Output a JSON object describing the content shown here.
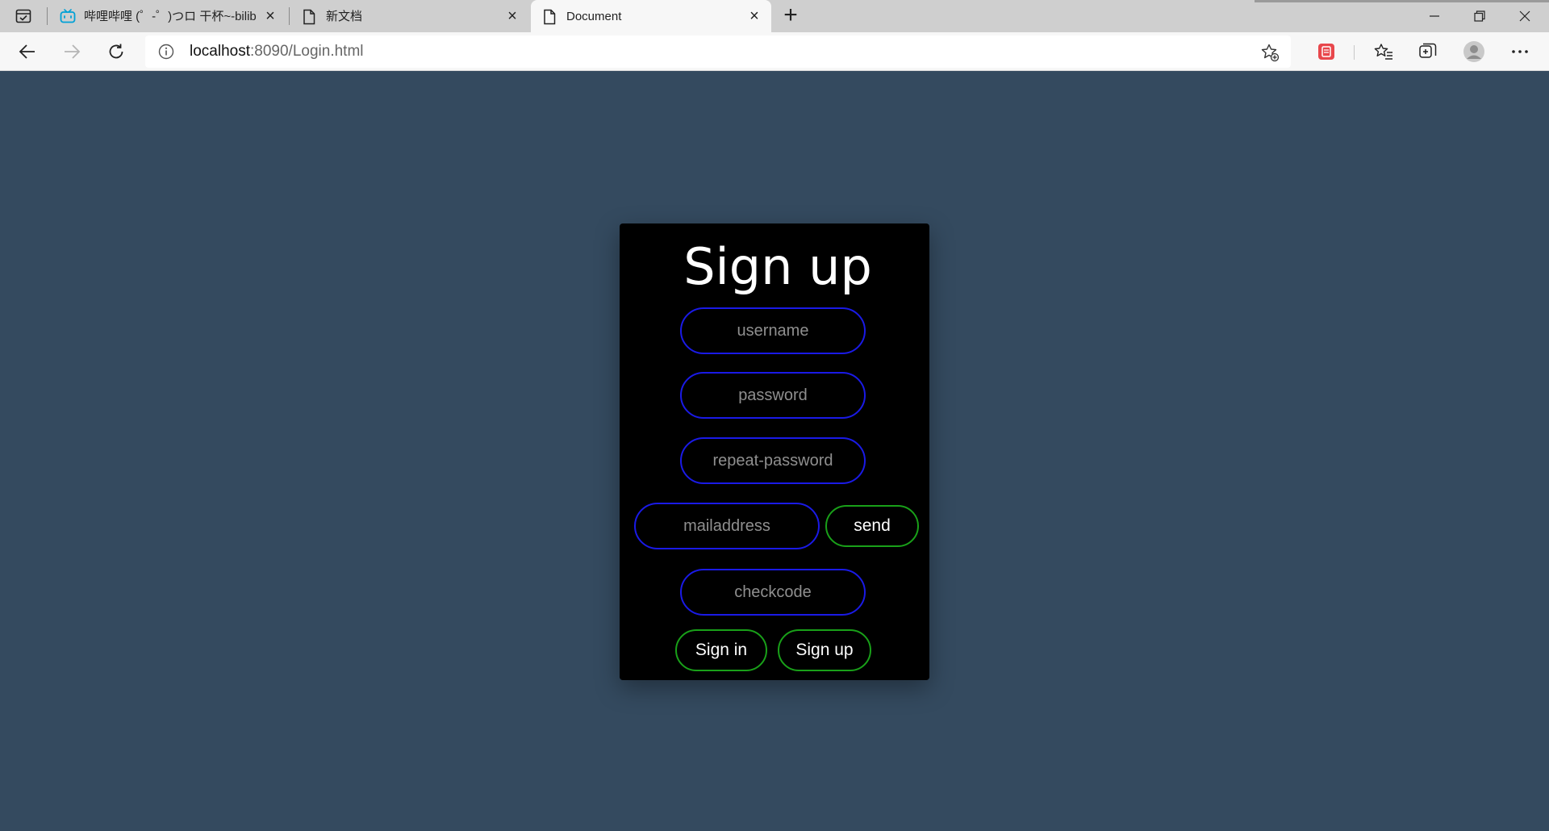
{
  "browser": {
    "tabs": [
      {
        "title": "哔哩哔哩 (゜-゜)つロ 干杯~-bilibili",
        "icon": "bilibili-tv-icon",
        "active": false
      },
      {
        "title": "新文档",
        "icon": "document-icon",
        "active": false
      },
      {
        "title": "Document",
        "icon": "document-icon",
        "active": true
      }
    ],
    "tab_close_glyph": "×",
    "new_tab_glyph": "+",
    "address": {
      "host": "localhost",
      "rest": ":8090/Login.html"
    },
    "colors": {
      "chrome": "#cfcfcf",
      "toolbar": "#f7f7f7",
      "bilibili_accent": "#00a1d6",
      "extension_red": "#e8474c"
    }
  },
  "page": {
    "background": "#344a5f",
    "title": "Sign up",
    "fields": {
      "username_placeholder": "username",
      "password_placeholder": "password",
      "repeat_password_placeholder": "repeat-password",
      "mail_placeholder": "mailaddress",
      "checkcode_placeholder": "checkcode"
    },
    "buttons": {
      "send": "send",
      "sign_in": "Sign in",
      "sign_up": "Sign up"
    },
    "colors": {
      "card": "#000000",
      "field_border": "#1a1ae6",
      "button_border": "#19a019"
    }
  }
}
